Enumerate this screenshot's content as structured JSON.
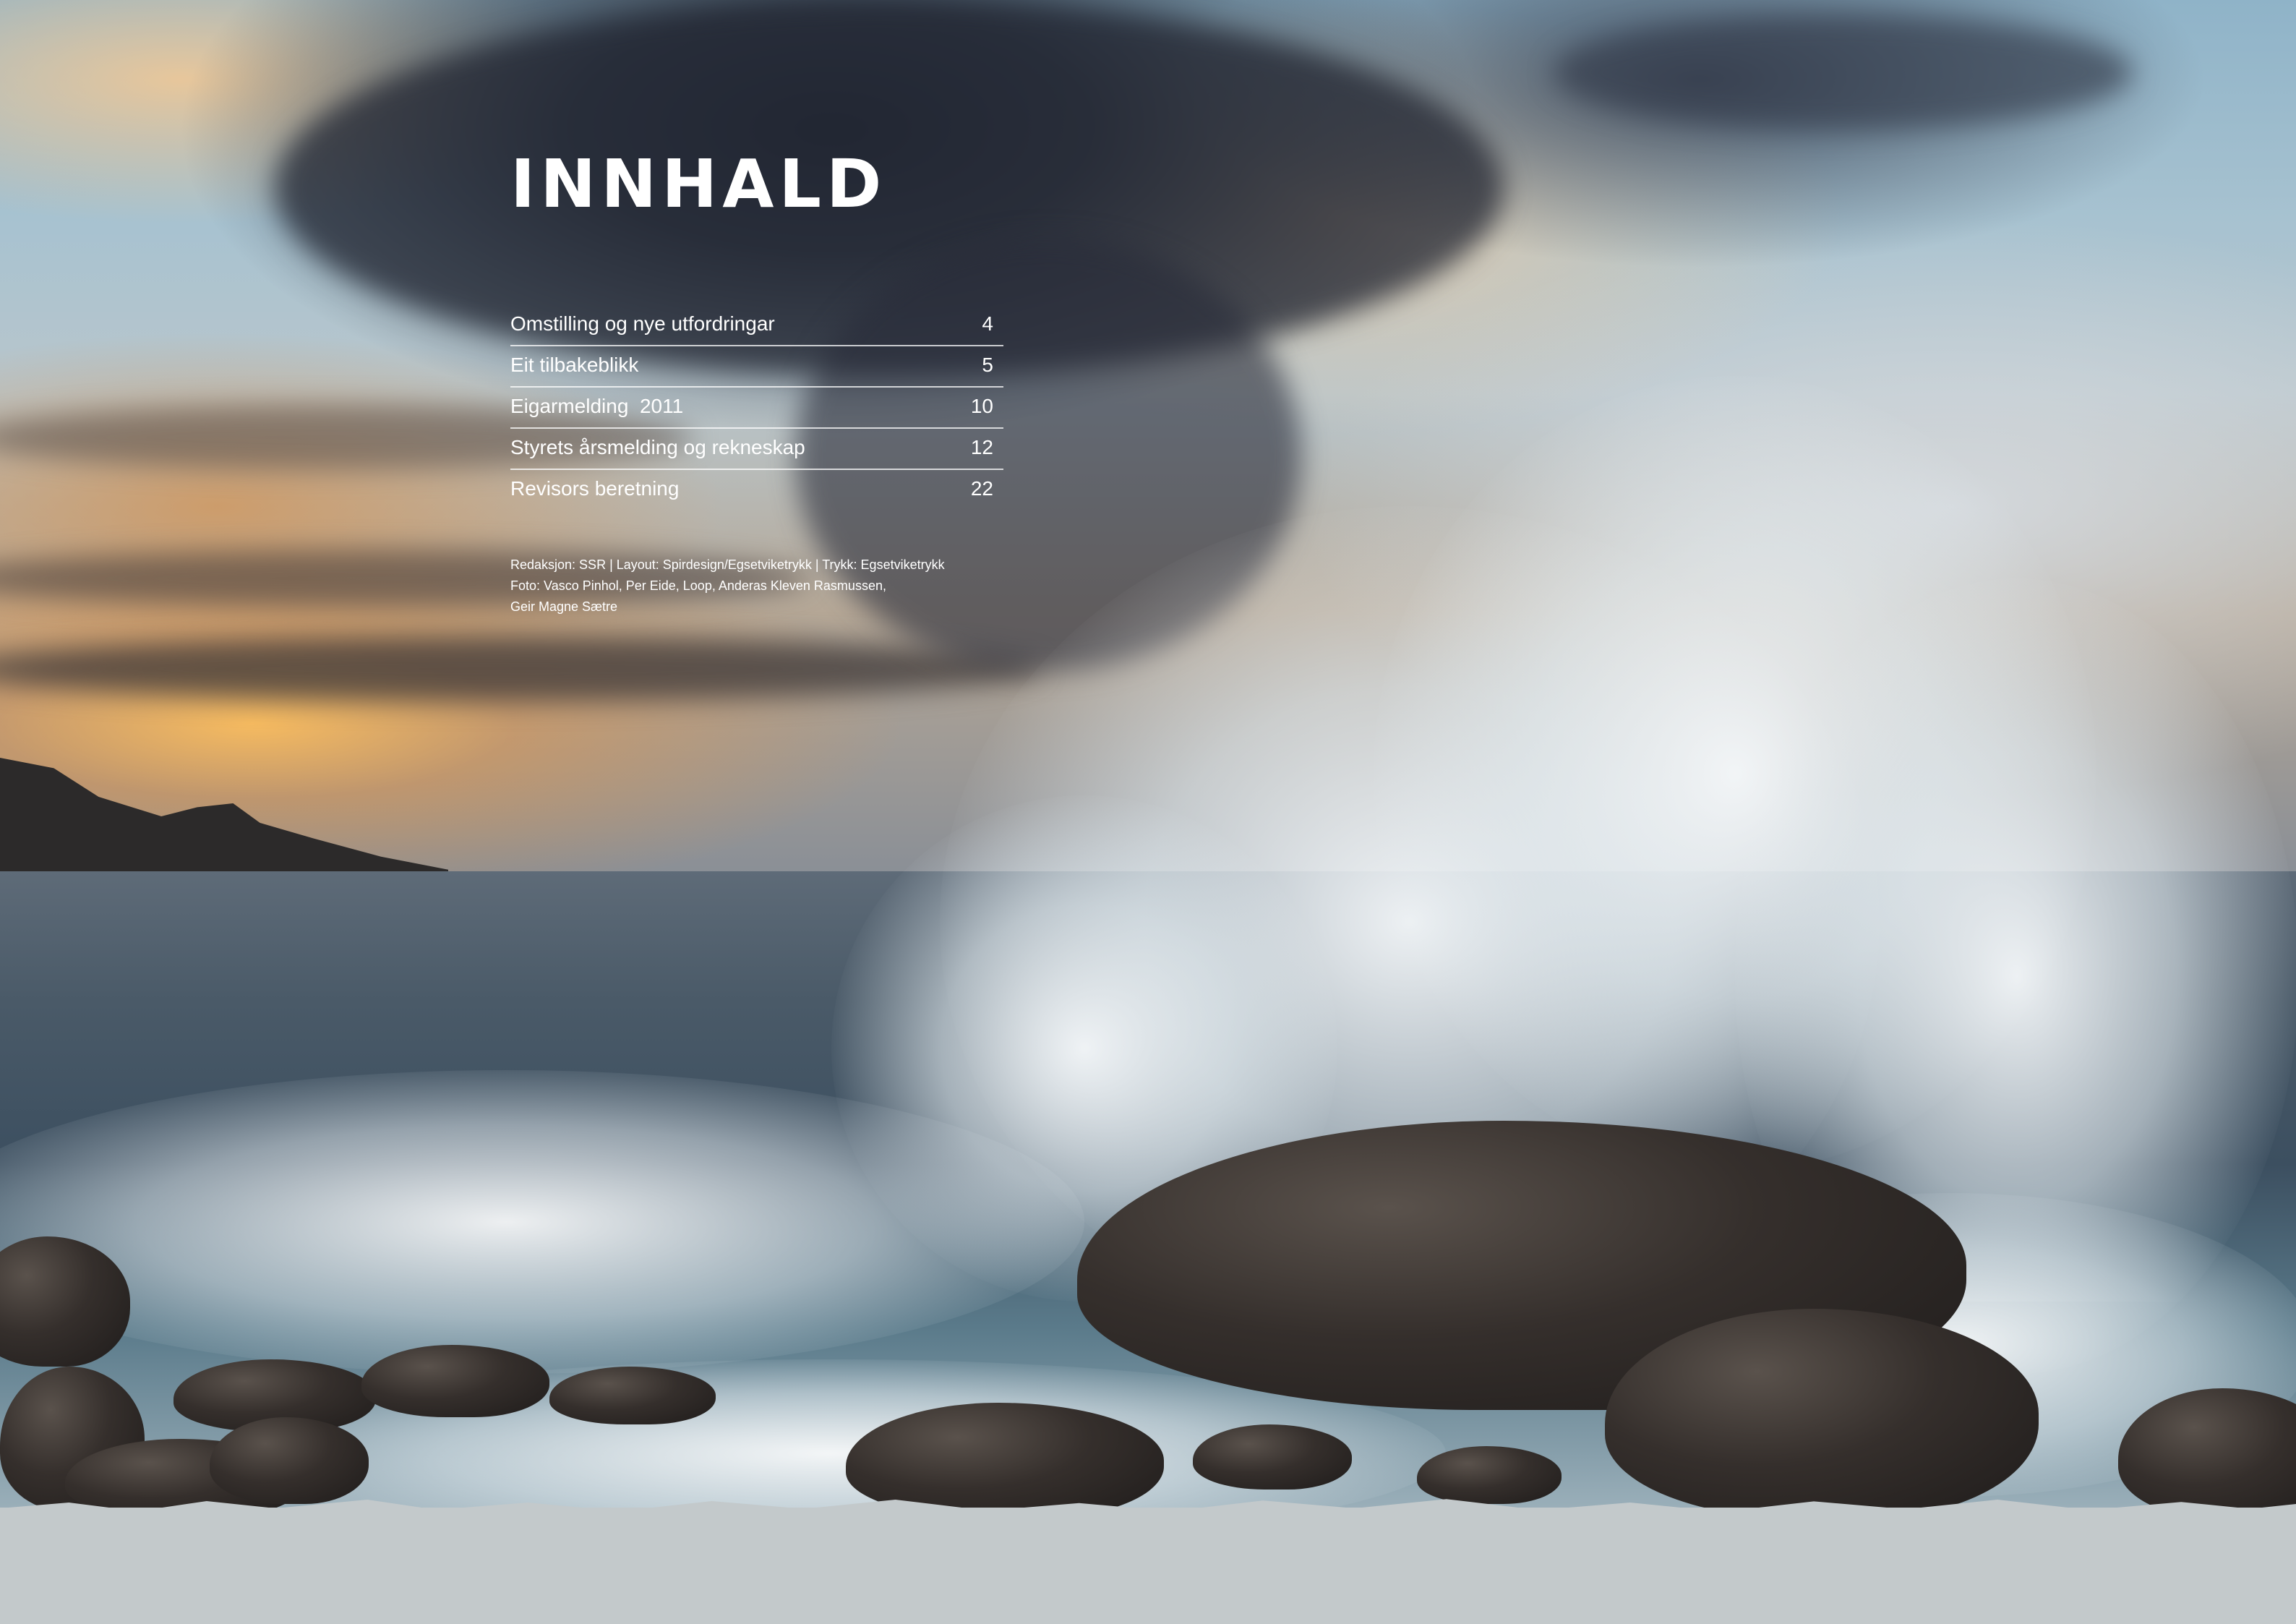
{
  "page": {
    "title": "INNHALD"
  },
  "toc": {
    "entries": [
      {
        "label": "Omstilling og nye utfordringar",
        "page": "4"
      },
      {
        "label": "Eit tilbakeblikk",
        "page": "5"
      },
      {
        "label": "Eigarmelding  2011",
        "page": "10"
      },
      {
        "label": "Styrets årsmelding og rekneskap",
        "page": "12"
      },
      {
        "label": "Revisors beretning",
        "page": "22"
      }
    ]
  },
  "credits": {
    "line1": "Redaksjon: SSR | Layout: Spirdesign/Egsetviketrykk | Trykk: Egsetviketrykk",
    "line2": "Foto: Vasco Pinhol, Per Eide, Loop, Anderas Kleven Rasmussen,",
    "line3": "Geir Magne Sætre"
  },
  "colors": {
    "text": "#ffffff",
    "bottom_band": "#c3c9cb"
  }
}
